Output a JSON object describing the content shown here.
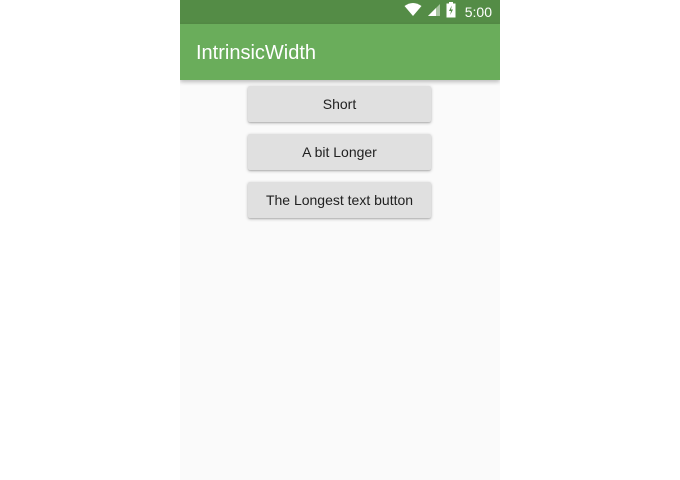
{
  "status_bar": {
    "time": "5:00",
    "icons": [
      "wifi-icon",
      "cell-signal-icon",
      "battery-icon"
    ],
    "color": "#548c46"
  },
  "app_bar": {
    "title": "IntrinsicWidth",
    "color": "#6aad5b"
  },
  "buttons": [
    {
      "label": "Short"
    },
    {
      "label": "A bit Longer"
    },
    {
      "label": "The Longest text button"
    }
  ],
  "colors": {
    "background": "#fafafa",
    "button": "#e0e0e0",
    "button_text": "#212121"
  }
}
